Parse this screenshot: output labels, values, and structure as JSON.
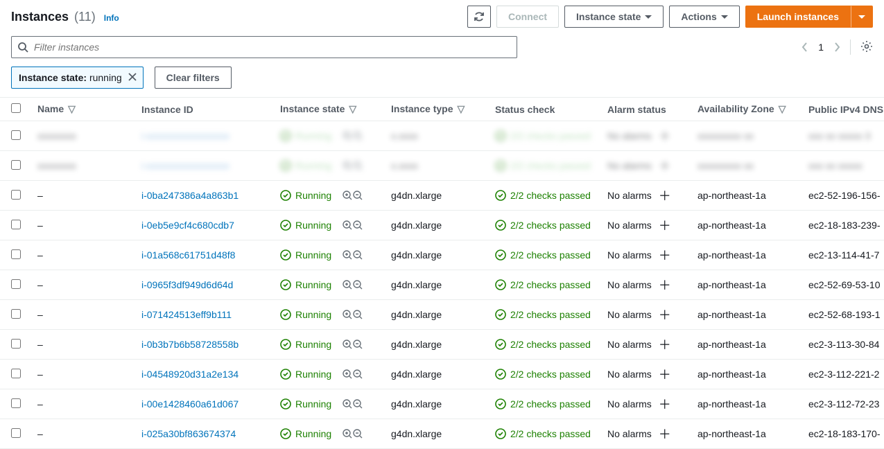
{
  "header": {
    "title": "Instances",
    "count": "(11)",
    "info": "Info",
    "buttons": {
      "connect": "Connect",
      "instance_state": "Instance state",
      "actions": "Actions",
      "launch": "Launch instances"
    }
  },
  "filter": {
    "placeholder": "Filter instances",
    "page": "1",
    "tag_label": "Instance state:",
    "tag_value": "running",
    "clear": "Clear filters"
  },
  "columns": {
    "name": "Name",
    "instance_id": "Instance ID",
    "instance_state": "Instance state",
    "instance_type": "Instance type",
    "status_check": "Status check",
    "alarm_status": "Alarm status",
    "az": "Availability Zone",
    "dns": "Public IPv4 DNS"
  },
  "blurred_rows": [
    {
      "name": "xxxxxxxx",
      "id": "i-xxxxxxxxxxxxxxxxx",
      "state": "Running",
      "type": "x.xxxx",
      "status": "2/2 checks passed",
      "alarm": "No alarms",
      "az": "xxxxxxxxx xx",
      "dns": "xxx xx xxxxx 3"
    },
    {
      "name": "xxxxxxxx",
      "id": "i-xxxxxxxxxxxxxxxxx",
      "state": "Running",
      "type": "x.xxxx",
      "status": "2/2 checks passed",
      "alarm": "No alarms",
      "az": "xxxxxxxxx xx",
      "dns": "xxx xx xxxxx"
    }
  ],
  "rows": [
    {
      "name": "–",
      "id": "i-0ba247386a4a863b1",
      "state": "Running",
      "type": "g4dn.xlarge",
      "status": "2/2 checks passed",
      "alarm": "No alarms",
      "az": "ap-northeast-1a",
      "dns": "ec2-52-196-156-"
    },
    {
      "name": "–",
      "id": "i-0eb5e9cf4c680cdb7",
      "state": "Running",
      "type": "g4dn.xlarge",
      "status": "2/2 checks passed",
      "alarm": "No alarms",
      "az": "ap-northeast-1a",
      "dns": "ec2-18-183-239-"
    },
    {
      "name": "–",
      "id": "i-01a568c61751d48f8",
      "state": "Running",
      "type": "g4dn.xlarge",
      "status": "2/2 checks passed",
      "alarm": "No alarms",
      "az": "ap-northeast-1a",
      "dns": "ec2-13-114-41-7"
    },
    {
      "name": "–",
      "id": "i-0965f3df949d6d64d",
      "state": "Running",
      "type": "g4dn.xlarge",
      "status": "2/2 checks passed",
      "alarm": "No alarms",
      "az": "ap-northeast-1a",
      "dns": "ec2-52-69-53-10"
    },
    {
      "name": "–",
      "id": "i-071424513eff9b111",
      "state": "Running",
      "type": "g4dn.xlarge",
      "status": "2/2 checks passed",
      "alarm": "No alarms",
      "az": "ap-northeast-1a",
      "dns": "ec2-52-68-193-1"
    },
    {
      "name": "–",
      "id": "i-0b3b7b6b58728558b",
      "state": "Running",
      "type": "g4dn.xlarge",
      "status": "2/2 checks passed",
      "alarm": "No alarms",
      "az": "ap-northeast-1a",
      "dns": "ec2-3-113-30-84"
    },
    {
      "name": "–",
      "id": "i-04548920d31a2e134",
      "state": "Running",
      "type": "g4dn.xlarge",
      "status": "2/2 checks passed",
      "alarm": "No alarms",
      "az": "ap-northeast-1a",
      "dns": "ec2-3-112-221-2"
    },
    {
      "name": "–",
      "id": "i-00e1428460a61d067",
      "state": "Running",
      "type": "g4dn.xlarge",
      "status": "2/2 checks passed",
      "alarm": "No alarms",
      "az": "ap-northeast-1a",
      "dns": "ec2-3-112-72-23"
    },
    {
      "name": "–",
      "id": "i-025a30bf863674374",
      "state": "Running",
      "type": "g4dn.xlarge",
      "status": "2/2 checks passed",
      "alarm": "No alarms",
      "az": "ap-northeast-1a",
      "dns": "ec2-18-183-170-"
    }
  ]
}
